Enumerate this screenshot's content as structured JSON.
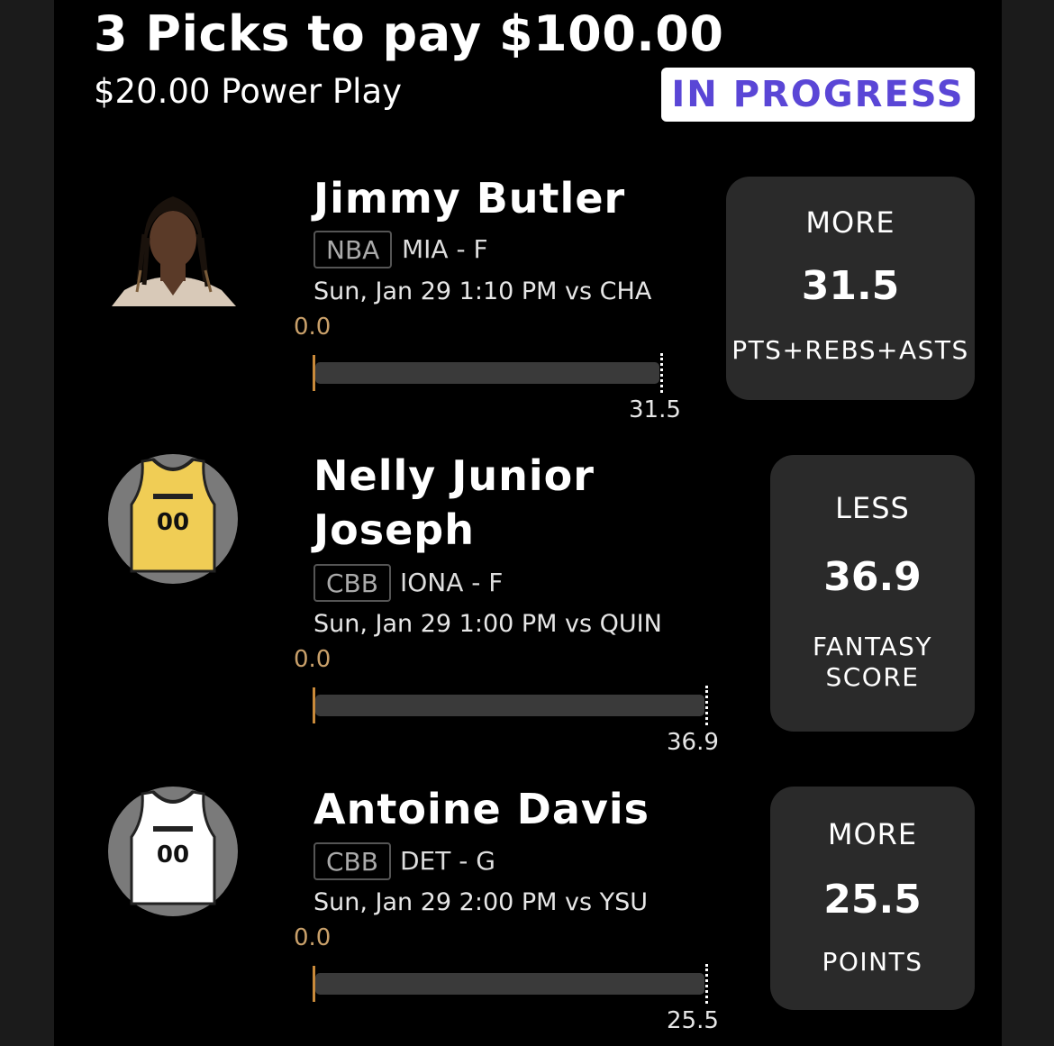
{
  "header": {
    "title": "3 Picks to pay $100.00",
    "subtitle": "$20.00 Power Play",
    "status": "IN PROGRESS"
  },
  "picks": [
    {
      "player": "Jimmy Butler",
      "league": "NBA",
      "team_pos": "MIA - F",
      "game": "Sun, Jan 29 1:10 PM  vs CHA",
      "progress_start": "0.0",
      "progress_target": "31.5",
      "progress_fraction": 0,
      "direction": "MORE",
      "line": "31.5",
      "stat": "PTS+REBS+ASTS",
      "avatar": "player-photo"
    },
    {
      "player": "Nelly Junior Joseph",
      "player_line1": "Nelly Junior",
      "player_line2": "Joseph",
      "league": "CBB",
      "team_pos": "IONA - F",
      "game": "Sun, Jan 29 1:00 PM  vs QUIN",
      "progress_start": "0.0",
      "progress_target": "36.9",
      "progress_fraction": 0,
      "direction": "LESS",
      "line": "36.9",
      "stat_line1": "FANTASY",
      "stat_line2": "SCORE",
      "avatar": "jersey-icon",
      "jersey_color": "#f0cd55",
      "jersey_number": "00"
    },
    {
      "player": "Antoine Davis",
      "league": "CBB",
      "team_pos": "DET - G",
      "game": "Sun, Jan 29 2:00 PM  vs YSU",
      "progress_start": "0.0",
      "progress_target": "25.5",
      "progress_fraction": 0,
      "direction": "MORE",
      "line": "25.5",
      "stat": "POINTS",
      "avatar": "jersey-icon",
      "jersey_color": "#ffffff",
      "jersey_number": "00"
    }
  ],
  "colors": {
    "status_text": "#5a46d6",
    "progress_start": "#c9a06a",
    "pick_box_bg": "#2a2a2a"
  }
}
